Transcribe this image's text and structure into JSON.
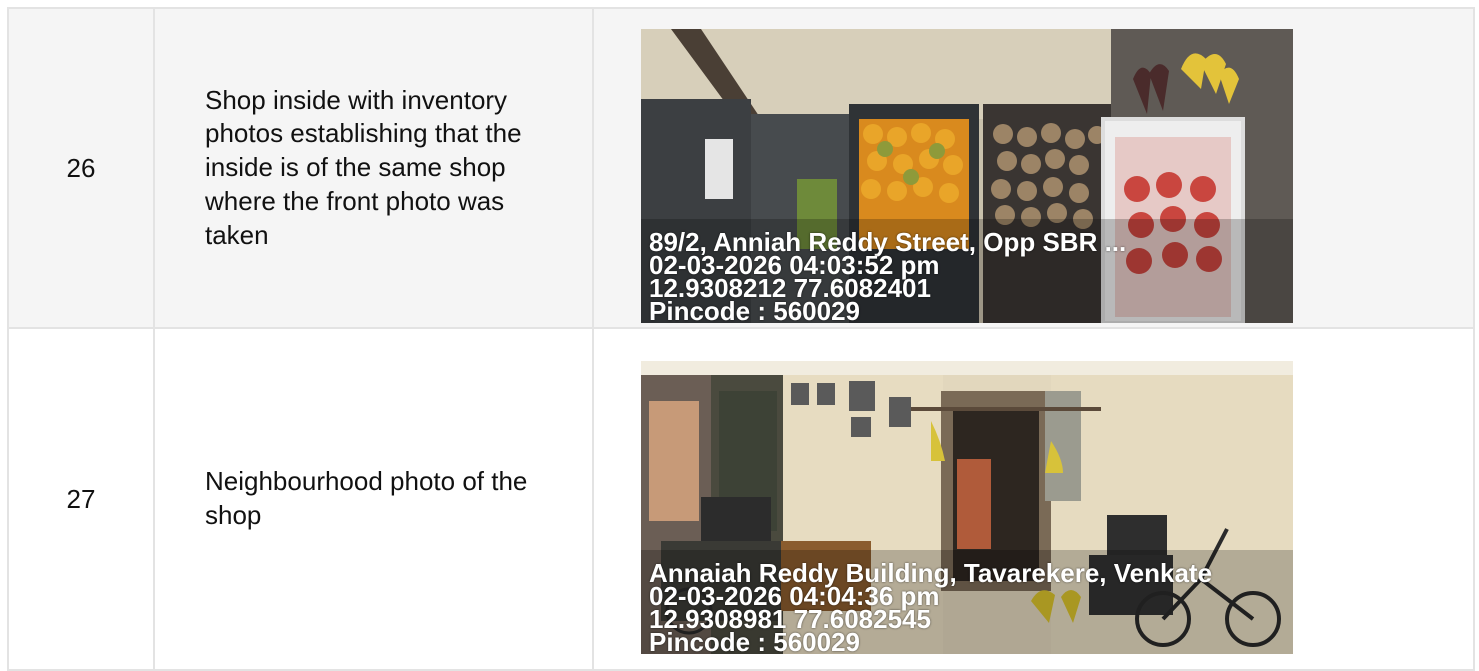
{
  "rows": [
    {
      "number": "26",
      "description": "Shop inside with inventory photos establishing that the inside is of the same shop where the front photo was taken",
      "photo": {
        "address": "89/2, Anniah Reddy Street, Opp SBR ...",
        "datetime": "02-03-2026 04:03:52 pm",
        "coords": "12.9308212 77.6082401",
        "pincode": "Pincode : 560029"
      }
    },
    {
      "number": "27",
      "description": "Neighbourhood photo of the shop",
      "photo": {
        "address": "Annaiah Reddy Building, Tavarekere, Venkate",
        "datetime": "02-03-2026 04:04:36 pm",
        "coords": "12.9308981 77.6082545",
        "pincode": "Pincode : 560029"
      }
    }
  ]
}
